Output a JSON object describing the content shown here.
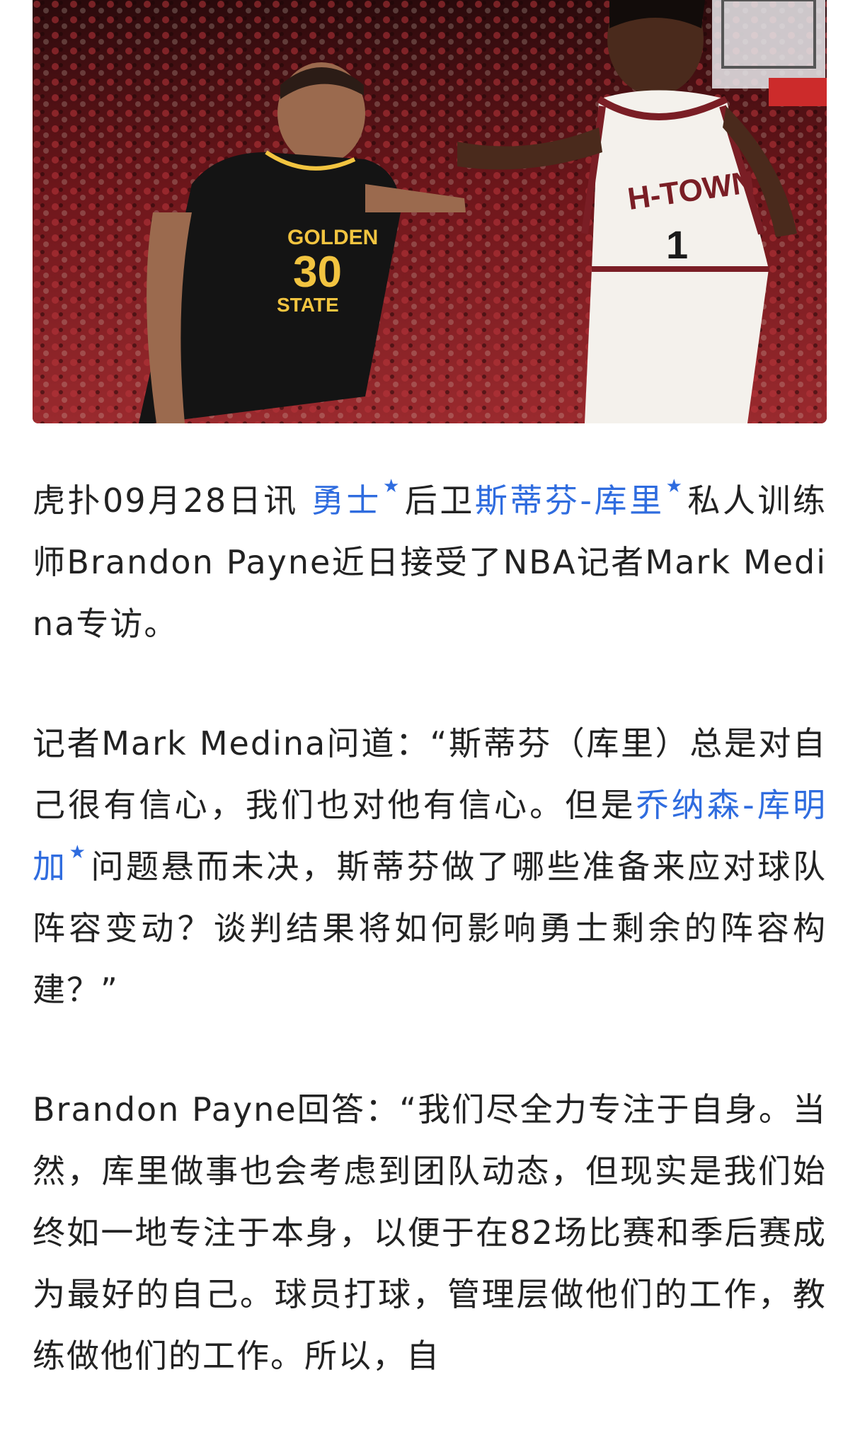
{
  "hero_image": {
    "alt": "",
    "colors": {
      "crowd": "#8e1f24",
      "warriors_jersey": "#141414",
      "warriors_number": "#f2c440",
      "rockets_jersey": "#f4f1ec",
      "rockets_trim": "#7a1e25"
    },
    "jersey_left": {
      "team": "GOLDEN",
      "city": "STATE",
      "number": "30"
    },
    "jersey_right": {
      "team": "H-TOWN",
      "number": "1"
    }
  },
  "paragraphs": {
    "p1": {
      "t1": "虎扑09月28日讯 ",
      "link1": "勇士",
      "t2": "后卫",
      "link2": "斯蒂芬-库里",
      "t3": "私人训练师Brandon Payne近日接受了NBA记者Mark Medina专访。"
    },
    "p2": {
      "t1": "记者Mark Medina问道：“斯蒂芬（库里）总是对自己很有信心，我们也对他有信心。但是",
      "link1": "乔纳森-库明加",
      "t2": "问题悬而未决，斯蒂芬做了哪些准备来应对球队阵容变动？谈判结果将如何影响勇士剩余的阵容构建？”"
    },
    "p3": {
      "t1": "Brandon Payne回答：“我们尽全力专注于自身。当然，库里做事也会考虑到团队动态，但现实是我们始终如一地专注于本身，以便于在82场比赛和季后赛成为最好的自己。球员打球，管理层做他们的工作，教练做他们的工作。所以，自"
    }
  },
  "icons": {
    "link_star": "★"
  },
  "colors": {
    "link": "#2f6cdf",
    "text": "#222222"
  }
}
